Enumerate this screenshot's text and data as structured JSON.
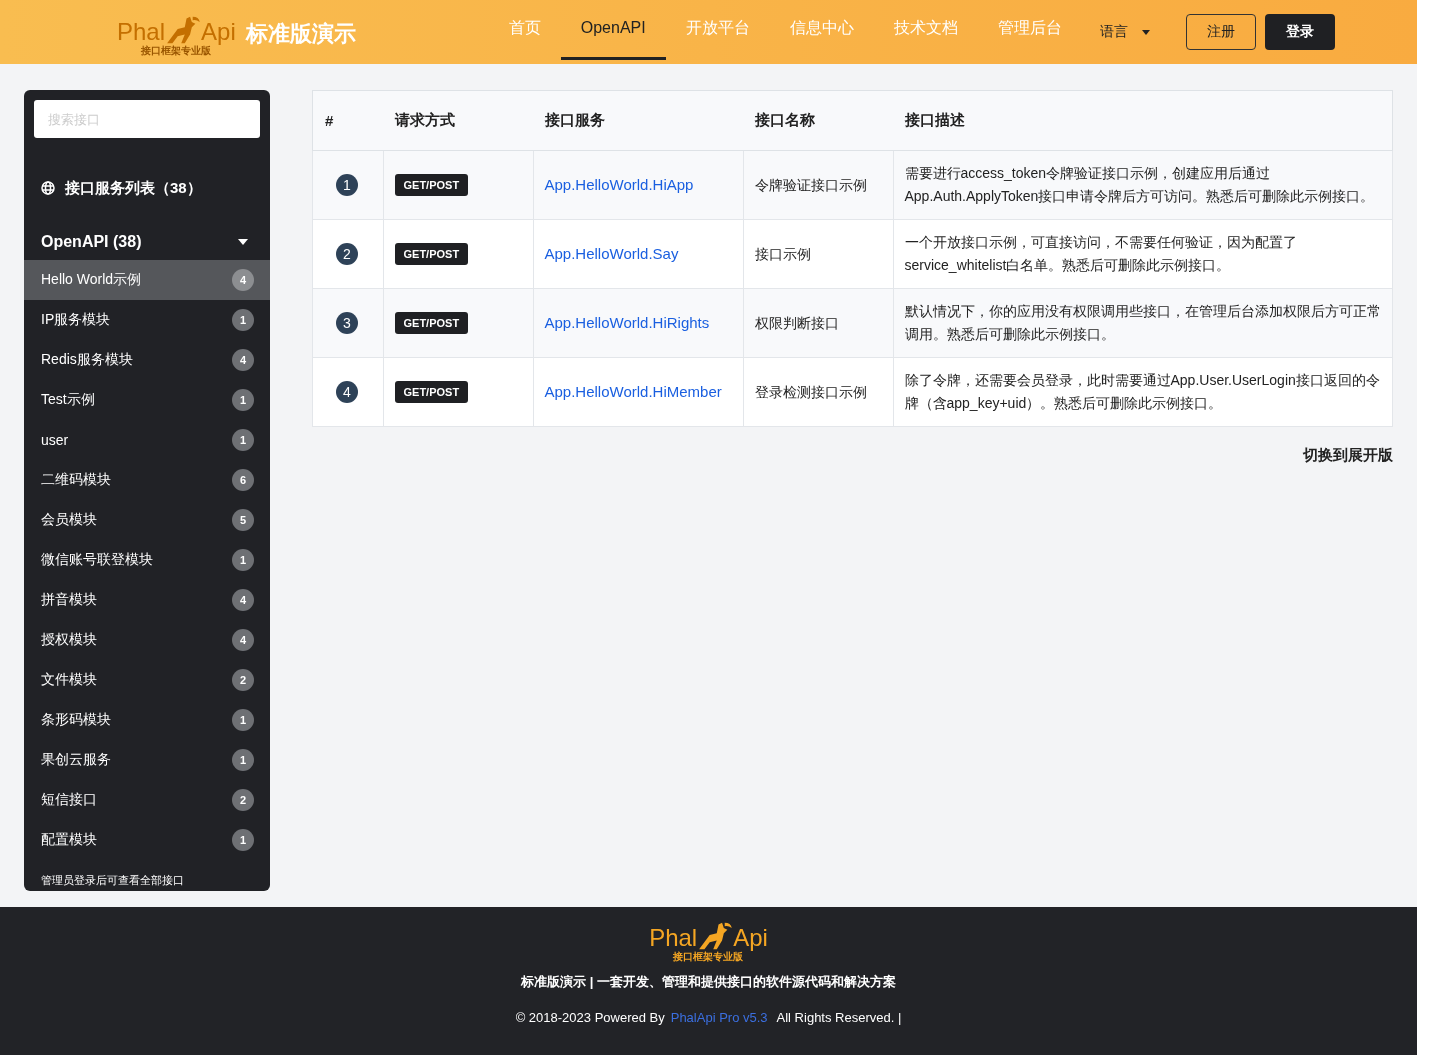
{
  "header": {
    "logo": {
      "word_left": "Phal",
      "word_right": "Api",
      "subtitle": "接口框架专业版"
    },
    "title": "标准版演示",
    "nav": [
      {
        "label": "首页",
        "selected": false
      },
      {
        "label": "OpenAPI",
        "selected": true
      },
      {
        "label": "开放平台",
        "selected": false
      },
      {
        "label": "信息中心",
        "selected": false
      },
      {
        "label": "技术文档",
        "selected": false
      },
      {
        "label": "管理后台",
        "selected": false
      }
    ],
    "language": "语言",
    "register": "注册",
    "login": "登录"
  },
  "sidebar": {
    "search": {
      "placeholder": "搜索接口"
    },
    "heading": "接口服务列表（38）",
    "group": {
      "label": "OpenAPI (38)",
      "expanded": true
    },
    "items": [
      {
        "label": "Hello World示例",
        "count": "4",
        "selected": true
      },
      {
        "label": "IP服务模块",
        "count": "1",
        "selected": false
      },
      {
        "label": "Redis服务模块",
        "count": "4",
        "selected": false
      },
      {
        "label": "Test示例",
        "count": "1",
        "selected": false
      },
      {
        "label": "user",
        "count": "1",
        "selected": false
      },
      {
        "label": "二维码模块",
        "count": "6",
        "selected": false
      },
      {
        "label": "会员模块",
        "count": "5",
        "selected": false
      },
      {
        "label": "微信账号联登模块",
        "count": "1",
        "selected": false
      },
      {
        "label": "拼音模块",
        "count": "4",
        "selected": false
      },
      {
        "label": "授权模块",
        "count": "4",
        "selected": false
      },
      {
        "label": "文件模块",
        "count": "2",
        "selected": false
      },
      {
        "label": "条形码模块",
        "count": "1",
        "selected": false
      },
      {
        "label": "果创云服务",
        "count": "1",
        "selected": false
      },
      {
        "label": "短信接口",
        "count": "2",
        "selected": false
      },
      {
        "label": "配置模块",
        "count": "1",
        "selected": false
      }
    ],
    "note": "管理员登录后可查看全部接口"
  },
  "table": {
    "columns": [
      "#",
      "请求方式",
      "接口服务",
      "接口名称",
      "接口描述"
    ],
    "rows": [
      {
        "number": "1",
        "method": "GET/POST",
        "service": "App.HelloWorld.HiApp",
        "name": "令牌验证接口示例",
        "description": "需要进行access_token令牌验证接口示例，创建应用后通过App.Auth.ApplyToken接口申请令牌后方可访问。熟悉后可删除此示例接口。"
      },
      {
        "number": "2",
        "method": "GET/POST",
        "service": "App.HelloWorld.Say",
        "name": "接口示例",
        "description": "一个开放接口示例，可直接访问，不需要任何验证，因为配置了service_whitelist白名单。熟悉后可删除此示例接口。"
      },
      {
        "number": "3",
        "method": "GET/POST",
        "service": "App.HelloWorld.HiRights",
        "name": "权限判断接口",
        "description": "默认情况下，你的应用没有权限调用些接口，在管理后台添加权限后方可正常调用。熟悉后可删除此示例接口。"
      },
      {
        "number": "4",
        "method": "GET/POST",
        "service": "App.HelloWorld.HiMember",
        "name": "登录检测接口示例",
        "description": "除了令牌，还需要会员登录，此时需要通过App.User.UserLogin接口返回的令牌（含app_key+uid）。熟悉后可删除此示例接口。"
      }
    ]
  },
  "switch_link": "切换到展开版",
  "footer": {
    "logo": {
      "word_left": "Phal",
      "word_right": "Api",
      "subtitle": "接口框架专业版"
    },
    "tagline": "标准版演示 | 一套开发、管理和提供接口的软件源代码和解决方案",
    "copyright": "© 2018-2023 Powered By",
    "product_link": "PhalApi Pro v5.3",
    "rights": "All Rights Reserved. |"
  }
}
